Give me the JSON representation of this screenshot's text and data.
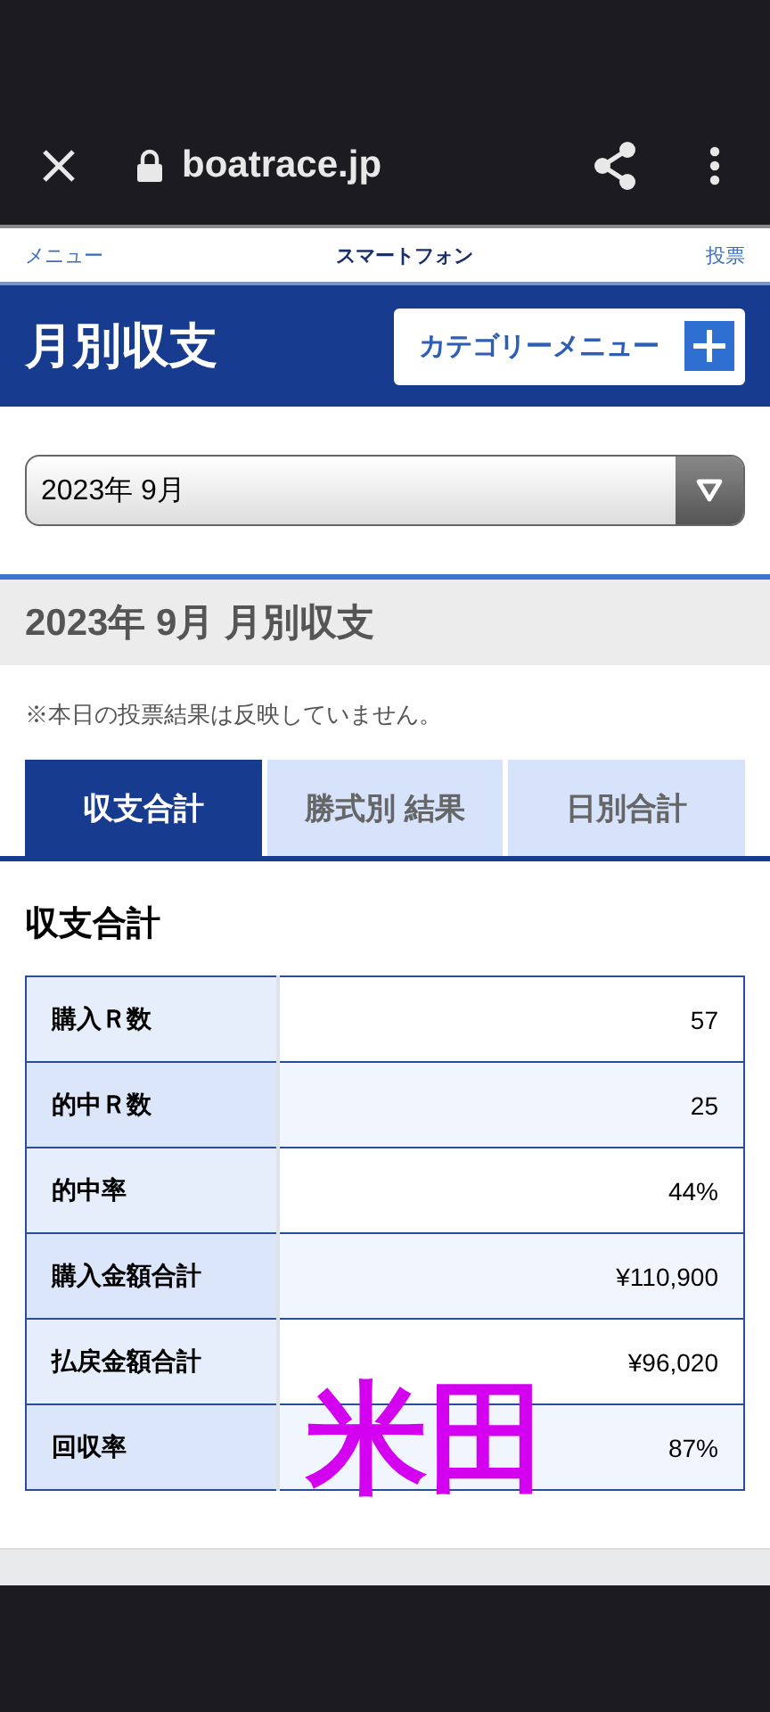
{
  "browser": {
    "url": "boatrace.jp"
  },
  "nav": {
    "left": "メニュー",
    "center": "スマートフォン",
    "right": "投票"
  },
  "header": {
    "title": "月別収支",
    "category_button": "カテゴリーメニュー"
  },
  "month_select": {
    "value": "2023年 9月"
  },
  "section_title": "2023年 9月 月別収支",
  "note": "※本日の投票結果は反映していません。",
  "tabs": [
    {
      "label": "収支合計",
      "selected": true
    },
    {
      "label": "勝式別 結果",
      "selected": false
    },
    {
      "label": "日別合計",
      "selected": false
    }
  ],
  "summary": {
    "title": "収支合計",
    "rows": [
      {
        "label": "購入Ｒ数",
        "value": "57"
      },
      {
        "label": "的中Ｒ数",
        "value": "25"
      },
      {
        "label": "的中率",
        "value": "44%"
      },
      {
        "label": "購入金額合計",
        "value": "¥110,900"
      },
      {
        "label": "払戻金額合計",
        "value": "¥96,020"
      },
      {
        "label": "回収率",
        "value": "87%"
      }
    ]
  },
  "overlay_text": "米田"
}
